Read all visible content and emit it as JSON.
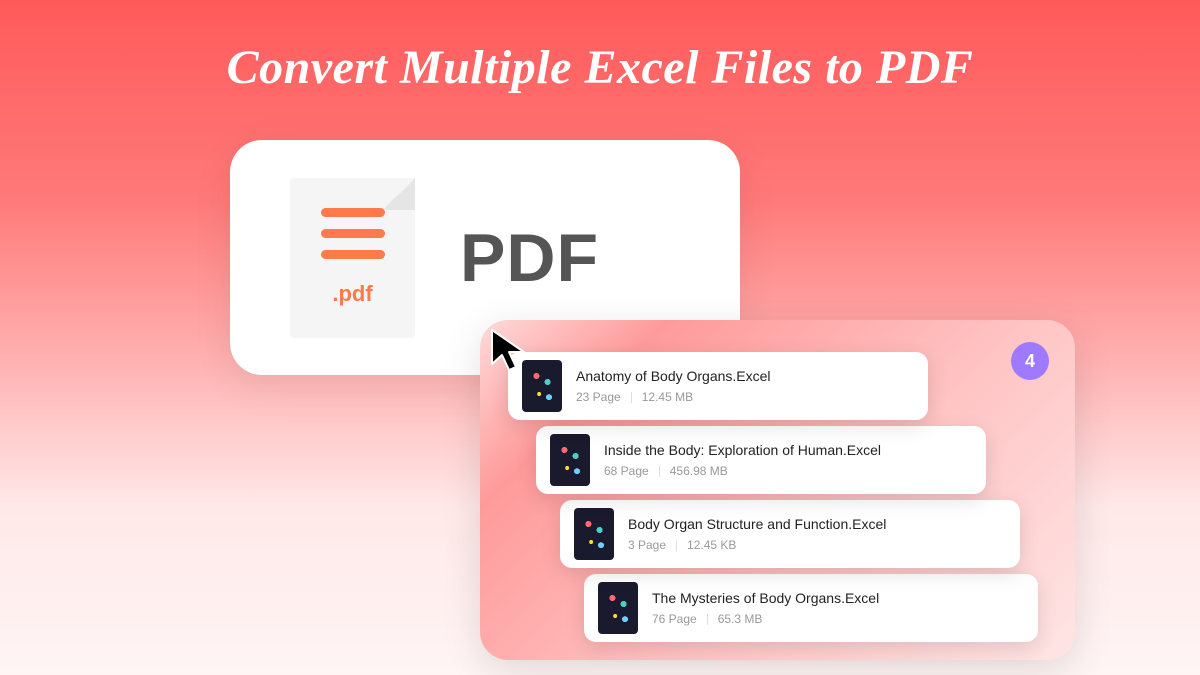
{
  "title": "Convert Multiple Excel Files to PDF",
  "pdf_card": {
    "ext": ".pdf",
    "label": "PDF"
  },
  "badge": "4",
  "files": [
    {
      "name": "Anatomy of Body Organs.Excel",
      "pages": "23 Page",
      "size": "12.45 MB"
    },
    {
      "name": "Inside the Body: Exploration of Human.Excel",
      "pages": "68 Page",
      "size": "456.98 MB"
    },
    {
      "name": "Body Organ Structure and Function.Excel",
      "pages": "3 Page",
      "size": "12.45 KB"
    },
    {
      "name": "The Mysteries of Body Organs.Excel",
      "pages": "76 Page",
      "size": "65.3 MB"
    }
  ]
}
